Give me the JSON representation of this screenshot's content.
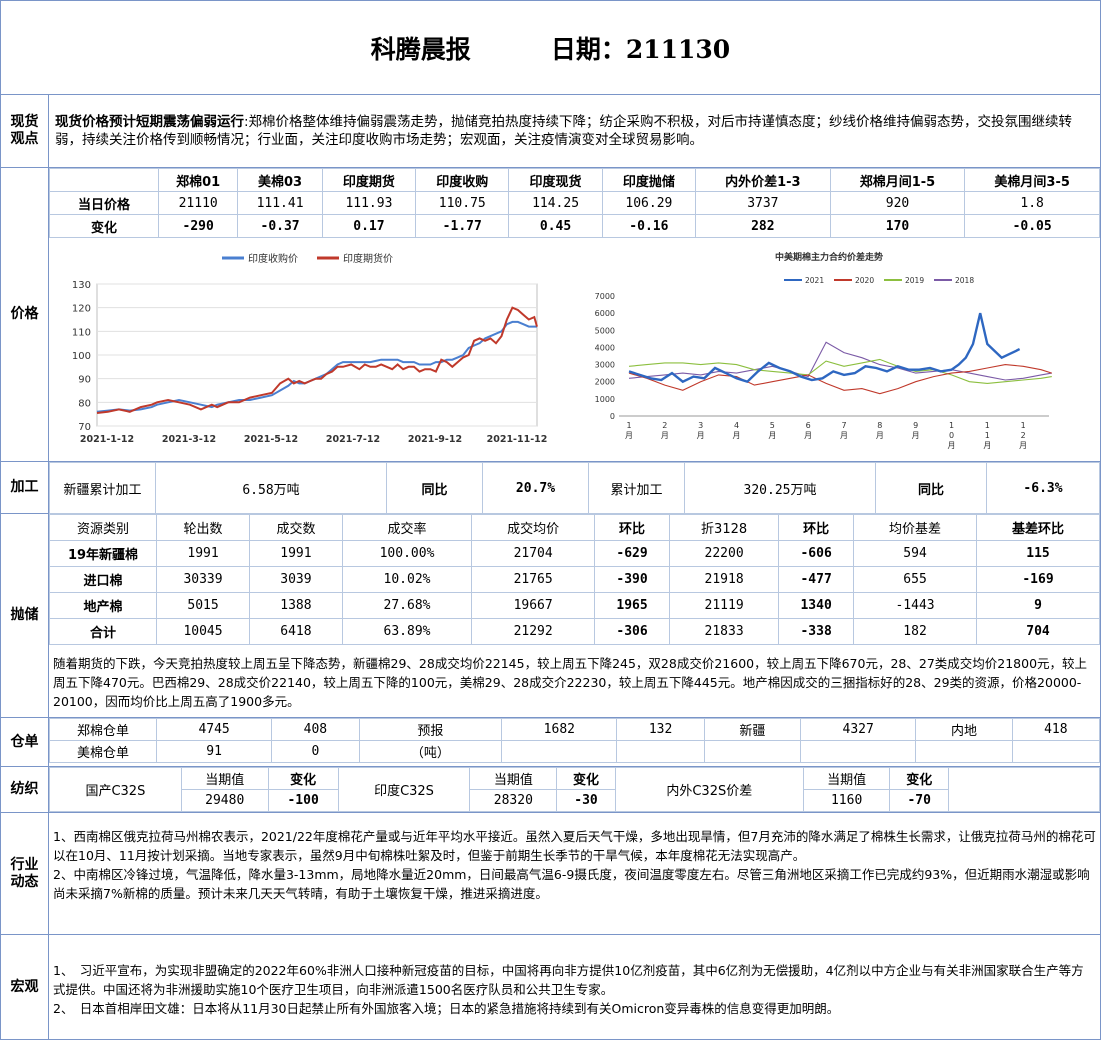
{
  "header": {
    "title": "科腾晨报",
    "date_label": "日期：211130"
  },
  "sections": {
    "spot": {
      "label": "现货\n观点",
      "heading": "现货价格预计短期震荡偏弱运行",
      "text": ":郑棉价格整体维持偏弱震荡走势，抛储竞拍热度持续下降；纺企采购不积极，对后市持谨慎态度；纱线价格维持偏弱态势，交投氛围继续转弱，持续关注价格传到顺畅情况；行业面，关注印度收购市场走势；宏观面，关注疫情演变对全球贸易影响。"
    },
    "price": {
      "label": "价格",
      "columns": [
        "郑棉01",
        "美棉03",
        "印度期货",
        "印度收购",
        "印度现货",
        "印度抛储",
        "内外价差1-3",
        "郑棉月间1-5",
        "美棉月间3-5"
      ],
      "row_today_label": "当日价格",
      "row_today": [
        "21110",
        "111.41",
        "111.93",
        "110.75",
        "114.25",
        "106.29",
        "3737",
        "920",
        "1.8"
      ],
      "row_change_label": "变化",
      "row_change": [
        "-290",
        "-0.37",
        "0.17",
        "-1.77",
        "0.45",
        "-0.16",
        "282",
        "170",
        "-0.05"
      ]
    },
    "process": {
      "label": "加工",
      "xj_label": "新疆累计加工",
      "xj_value": "6.58万吨",
      "yoy_label": "同比",
      "xj_yoy": "20.7%",
      "total_label": "累计加工",
      "total_value": "320.25万吨",
      "yoy_label2": "同比",
      "total_yoy": "-6.3%"
    },
    "reserve": {
      "label": "抛储",
      "headers": [
        "资源类别",
        "轮出数",
        "成交数",
        "成交率",
        "成交均价",
        "环比",
        "折3128",
        "环比",
        "均价基差",
        "基差环比"
      ],
      "rows": [
        [
          "19年新疆棉",
          "1991",
          "1991",
          "100.00%",
          "21704",
          "-629",
          "22200",
          "-606",
          "594",
          "115"
        ],
        [
          "进口棉",
          "30339",
          "3039",
          "10.02%",
          "21765",
          "-390",
          "21918",
          "-477",
          "655",
          "-169"
        ],
        [
          "地产棉",
          "5015",
          "1388",
          "27.68%",
          "19667",
          "1965",
          "21119",
          "1340",
          "-1443",
          "9"
        ],
        [
          "合计",
          "10045",
          "6418",
          "63.89%",
          "21292",
          "-306",
          "21833",
          "-338",
          "182",
          "704"
        ]
      ],
      "note": "随着期货的下跌，今天竞拍热度较上周五呈下降态势，新疆棉29、28成交均价22145，较上周五下降245，双28成交价21600，较上周五下降670元，28、27类成交均价21800元，较上周五下降470元。巴西棉29、28成交价22140，较上周五下降的100元，美棉29、28成交介22230，较上周五下降445元。地产棉因成交的三捆指标好的28、29类的资源，价格20000-20100，因而均价比上周五高了1900多元。"
    },
    "warehouse": {
      "label": "仓单",
      "r1": [
        "郑棉仓单",
        "4745",
        "408",
        "预报",
        "1682",
        "132",
        "新疆",
        "4327",
        "内地",
        "418"
      ],
      "r2": [
        "美棉仓单",
        "91",
        "0",
        "（吨）"
      ]
    },
    "spinning": {
      "label": "纺织",
      "cur_label": "当期值",
      "chg_label": "变化",
      "items": [
        {
          "name": "国产C32S",
          "value": "29480",
          "change": "-100"
        },
        {
          "name": "印度C32S",
          "value": "28320",
          "change": "-30"
        },
        {
          "name": "内外C32S价差",
          "value": "1160",
          "change": "-70"
        }
      ]
    },
    "industry": {
      "label": "行业\n动态",
      "p1": "1、西南棉区俄克拉荷马州棉农表示，2021/22年度棉花产量或与近年平均水平接近。虽然入夏后天气干燥，多地出现旱情，但7月充沛的降水满足了棉株生长需求，让俄克拉荷马州的棉花可以在10月、11月按计划采摘。当地专家表示，虽然9月中旬棉株吐絮及时，但鉴于前期生长季节的干旱气候，本年度棉花无法实现高产。",
      "p2": "2、中南棉区冷锋过境，气温降低，降水量3-13mm，局地降水量近20mm，日间最高气温6-9摄氏度，夜间温度零度左右。尽管三角洲地区采摘工作已完成约93%，但近期雨水潮湿或影响尚未采摘7%新棉的质量。预计未来几天天气转晴，有助于土壤恢复干燥，推进采摘进度。"
    },
    "macro": {
      "label": "宏观",
      "p1": "1、　习近平宣布，为实现非盟确定的2022年60%非洲人口接种新冠疫苗的目标，中国将再向非方提供10亿剂疫苗，其中6亿剂为无偿援助，4亿剂以中方企业与有关非洲国家联合生产等方式提供。中国还将为非洲援助实施10个医疗卫生项目，向非洲派遣1500名医疗队员和公共卫生专家。",
      "p2": "2、　日本首相岸田文雄：日本将从11月30日起禁止所有外国旅客入境；日本的紧急措施将持续到有关Omicron变异毒株的信息变得更加明朗。"
    }
  },
  "chart_data": [
    {
      "type": "line",
      "legend": [
        "印度收购价",
        "印度期货价"
      ],
      "legend_position": "top",
      "ylim": [
        70,
        130
      ],
      "yticks": [
        70,
        80,
        90,
        100,
        110,
        120,
        130
      ],
      "x_tick_labels": [
        "2021-1-12",
        "2021-3-12",
        "2021-5-12",
        "2021-7-12",
        "2021-9-12",
        "2021-11-12"
      ],
      "colors": [
        "#4a7fd0",
        "#c0392b"
      ],
      "series": [
        {
          "name": "印度收购价",
          "x": [
            0,
            8,
            16,
            24,
            32,
            40,
            44,
            52,
            60,
            68,
            76,
            84,
            88,
            96,
            104,
            112,
            120,
            128,
            134,
            140,
            144,
            148,
            152,
            156,
            160,
            164,
            168,
            172,
            176,
            180,
            186,
            192,
            196,
            200,
            204,
            208,
            212,
            216,
            220,
            224,
            228,
            232,
            236,
            240,
            244,
            248,
            252,
            256,
            260,
            264,
            268,
            272,
            276,
            280,
            284,
            288,
            292,
            296,
            300,
            304,
            308,
            312,
            316,
            320,
            322
          ],
          "values": [
            76,
            76.5,
            77,
            76.5,
            77,
            78,
            79,
            80,
            81,
            80,
            79,
            78,
            79,
            80,
            81,
            81,
            82,
            83,
            85,
            87,
            89,
            88,
            88,
            89,
            90,
            91,
            92,
            94,
            96,
            97,
            97,
            97,
            97,
            97,
            97.5,
            98,
            98,
            98,
            98,
            97,
            97,
            97,
            96,
            96,
            96,
            97,
            97,
            98,
            98,
            99,
            100,
            103,
            104,
            105,
            107,
            108,
            109,
            110,
            113,
            114,
            114,
            113,
            112,
            112,
            112
          ]
        },
        {
          "name": "印度期货价",
          "x": [
            0,
            8,
            16,
            24,
            32,
            40,
            44,
            52,
            60,
            68,
            76,
            84,
            88,
            96,
            104,
            112,
            120,
            128,
            134,
            140,
            144,
            148,
            152,
            156,
            160,
            164,
            168,
            172,
            176,
            180,
            186,
            192,
            196,
            200,
            204,
            208,
            212,
            216,
            220,
            224,
            228,
            232,
            236,
            240,
            244,
            248,
            252,
            256,
            260,
            264,
            268,
            272,
            276,
            280,
            284,
            288,
            292,
            296,
            300,
            304,
            308,
            312,
            316,
            320,
            322
          ],
          "values": [
            75.5,
            76,
            77,
            76,
            78,
            79,
            80,
            81,
            80,
            79,
            77,
            79,
            78,
            80,
            80,
            82,
            83,
            84,
            88,
            90,
            88,
            89,
            88,
            89,
            90,
            90,
            92,
            93,
            95,
            95,
            96,
            94,
            96,
            95,
            95,
            96,
            95,
            94,
            96,
            94,
            95,
            95,
            93,
            94,
            94,
            93,
            98,
            97,
            95,
            97,
            99,
            100,
            106,
            107,
            106,
            107,
            105,
            108,
            115,
            120,
            119,
            117,
            115,
            116,
            112
          ]
        }
      ]
    },
    {
      "type": "line",
      "title": "中美期棉主力合约价差走势",
      "legend": [
        "2021",
        "2020",
        "2019",
        "2018"
      ],
      "legend_position": "top",
      "ylim": [
        0,
        7000
      ],
      "yticks": [
        0,
        1000,
        2000,
        3000,
        4000,
        5000,
        6000,
        7000
      ],
      "x_tick_labels": [
        "1\n月",
        "2\n月",
        "3\n月",
        "4\n月",
        "5\n月",
        "6\n月",
        "7\n月",
        "8\n月",
        "9\n月",
        "1\n0\n月",
        "1\n1\n月",
        "1\n2\n月"
      ],
      "colors": [
        "#2e67c1",
        "#c0392b",
        "#8cbf3f",
        "#7b5aa6"
      ],
      "series": [
        {
          "name": "2021",
          "x": [
            0,
            0.3,
            0.6,
            0.9,
            1.2,
            1.5,
            1.8,
            2.1,
            2.4,
            2.7,
            3.0,
            3.3,
            3.6,
            3.9,
            4.2,
            4.5,
            4.8,
            5.1,
            5.4,
            5.7,
            6.0,
            6.3,
            6.6,
            6.9,
            7.2,
            7.5,
            7.8,
            8.1,
            8.4,
            8.7,
            9.0,
            9.2,
            9.4,
            9.6,
            9.8,
            10.0,
            10.2,
            10.4,
            10.6,
            10.8,
            10.9
          ],
          "values": [
            2600,
            2400,
            2200,
            2100,
            2500,
            2000,
            2300,
            2200,
            2800,
            2500,
            2200,
            2000,
            2600,
            3100,
            2800,
            2600,
            2300,
            2100,
            2200,
            2600,
            2400,
            2500,
            2900,
            2800,
            2600,
            2900,
            2700,
            2700,
            2800,
            2600,
            2700,
            3000,
            3400,
            4200,
            6000,
            4200,
            3800,
            3400,
            3600,
            3800,
            3900
          ]
        },
        {
          "name": "2020",
          "x": [
            0,
            0.5,
            1.0,
            1.5,
            2.0,
            2.5,
            3.0,
            3.5,
            4.0,
            4.5,
            5.0,
            5.5,
            6.0,
            6.5,
            7.0,
            7.5,
            8.0,
            8.5,
            9.0,
            9.5,
            10.0,
            10.5,
            11.0,
            11.5,
            11.8
          ],
          "values": [
            2500,
            2200,
            1800,
            1500,
            2000,
            2400,
            2300,
            1800,
            2000,
            2200,
            2400,
            1900,
            1500,
            1600,
            1300,
            1600,
            2000,
            2300,
            2500,
            2600,
            2800,
            3000,
            2900,
            2700,
            2500
          ]
        },
        {
          "name": "2019",
          "x": [
            0,
            0.5,
            1.0,
            1.5,
            2.0,
            2.5,
            3.0,
            3.5,
            4.0,
            4.5,
            5.0,
            5.5,
            6.0,
            6.5,
            7.0,
            7.5,
            8.0,
            8.5,
            9.0,
            9.5,
            10.0,
            10.5,
            11.0,
            11.5,
            11.8
          ],
          "values": [
            2900,
            3000,
            3100,
            3100,
            3000,
            3100,
            3000,
            2700,
            2600,
            2500,
            2400,
            3200,
            2900,
            3100,
            3300,
            2900,
            2600,
            2700,
            2400,
            2000,
            1900,
            2000,
            2100,
            2200,
            2300
          ]
        },
        {
          "name": "2018",
          "x": [
            0,
            0.5,
            1.0,
            1.5,
            2.0,
            2.5,
            3.0,
            3.5,
            4.0,
            4.5,
            5.0,
            5.5,
            6.0,
            6.5,
            7.0,
            7.5,
            8.0,
            8.5,
            9.0,
            9.5,
            10.0,
            10.5,
            11.0,
            11.5,
            11.8
          ],
          "values": [
            2200,
            2300,
            2400,
            2500,
            2400,
            2600,
            2500,
            2700,
            2900,
            2600,
            2300,
            4300,
            3700,
            3400,
            3000,
            2800,
            2500,
            2600,
            2700,
            2500,
            2300,
            2100,
            2200,
            2400,
            2500
          ]
        }
      ]
    }
  ]
}
